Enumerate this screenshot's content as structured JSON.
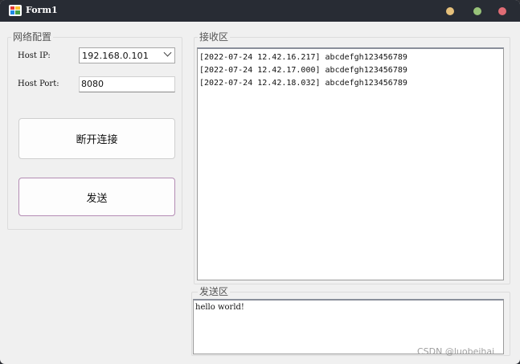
{
  "window": {
    "title": "Form1",
    "colors": {
      "titlebar": "#282c34",
      "minimize": "#e5c07b",
      "maximize": "#98c379",
      "close": "#e06c75"
    }
  },
  "network_group": {
    "title": "网络配置",
    "host_ip_label": "Host IP:",
    "host_ip_value": "192.168.0.101",
    "host_port_label": "Host Port:",
    "host_port_value": "8080",
    "disconnect_button": "断开连接",
    "send_button": "发送"
  },
  "receive_group": {
    "title": "接收区",
    "lines": [
      "[2022-07-24 12.42.16.217] abcdefgh123456789",
      "[2022-07-24 12.42.17.000] abcdefgh123456789",
      "[2022-07-24 12.42.18.032] abcdefgh123456789"
    ]
  },
  "send_group": {
    "title": "发送区",
    "text": "hello world!"
  },
  "watermark": "CSDN @luobeihai"
}
